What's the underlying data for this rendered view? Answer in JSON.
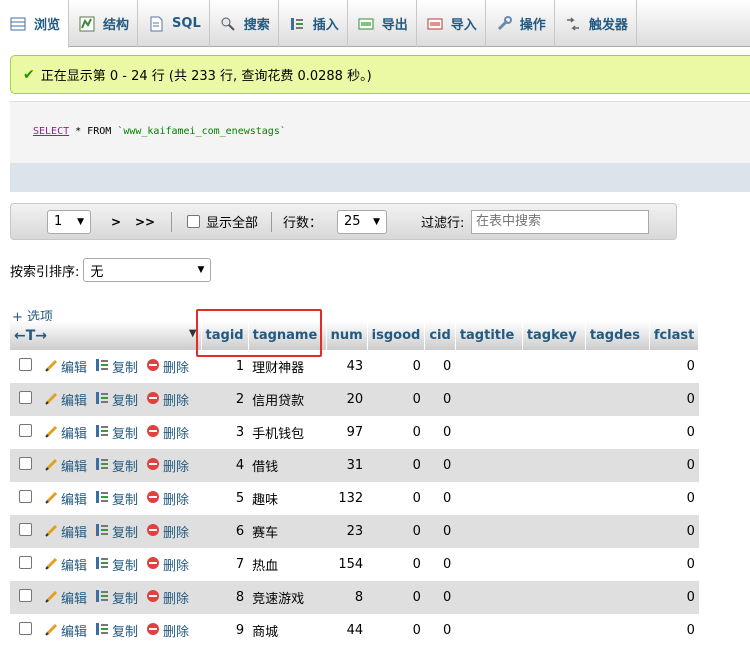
{
  "tabs": [
    {
      "label": "浏览",
      "icon": "browse-icon",
      "active": true
    },
    {
      "label": "结构",
      "icon": "structure-icon"
    },
    {
      "label": "SQL",
      "icon": "sql-icon"
    },
    {
      "label": "搜索",
      "icon": "search-icon"
    },
    {
      "label": "插入",
      "icon": "insert-icon"
    },
    {
      "label": "导出",
      "icon": "export-icon"
    },
    {
      "label": "导入",
      "icon": "import-icon"
    },
    {
      "label": "操作",
      "icon": "wrench-icon"
    },
    {
      "label": "触发器",
      "icon": "trigger-icon"
    }
  ],
  "message": "正在显示第 0 - 24 行 (共 233 行, 查询花费 0.0288 秒。)",
  "sql": {
    "keyword1": "SELECT",
    "rest": " * FROM ",
    "table": "`www_kaifamei_com_enewstags`"
  },
  "nav": {
    "page": "1",
    "next": ">",
    "last": ">>",
    "show_all": "显示全部",
    "rows_label": "行数：",
    "rows_value": "25",
    "filter_label": "过滤行:",
    "filter_placeholder": "在表中搜索"
  },
  "sort": {
    "label": "按索引排序:",
    "value": "无"
  },
  "options_link": "+ 选项",
  "columns": [
    "tagid",
    "tagname",
    "num",
    "isgood",
    "cid",
    "tagtitle",
    "tagkey",
    "tagdes",
    "fclast"
  ],
  "actions": {
    "edit": "编辑",
    "copy": "复制",
    "delete": "删除"
  },
  "rows": [
    {
      "tagid": "1",
      "tagname": "理财神器",
      "num": "43",
      "isgood": "0",
      "cid": "0",
      "fclast": "0"
    },
    {
      "tagid": "2",
      "tagname": "信用贷款",
      "num": "20",
      "isgood": "0",
      "cid": "0",
      "fclast": "0"
    },
    {
      "tagid": "3",
      "tagname": "手机钱包",
      "num": "97",
      "isgood": "0",
      "cid": "0",
      "fclast": "0"
    },
    {
      "tagid": "4",
      "tagname": "借钱",
      "num": "31",
      "isgood": "0",
      "cid": "0",
      "fclast": "0"
    },
    {
      "tagid": "5",
      "tagname": "趣味",
      "num": "132",
      "isgood": "0",
      "cid": "0",
      "fclast": "0"
    },
    {
      "tagid": "6",
      "tagname": "赛车",
      "num": "23",
      "isgood": "0",
      "cid": "0",
      "fclast": "0"
    },
    {
      "tagid": "7",
      "tagname": "热血",
      "num": "154",
      "isgood": "0",
      "cid": "0",
      "fclast": "0"
    },
    {
      "tagid": "8",
      "tagname": "竞速游戏",
      "num": "8",
      "isgood": "0",
      "cid": "0",
      "fclast": "0"
    },
    {
      "tagid": "9",
      "tagname": "商城",
      "num": "44",
      "isgood": "0",
      "cid": "0",
      "fclast": "0"
    }
  ],
  "colors": {
    "link": "#235a81",
    "success_bg": "#ebf8a4",
    "highlight": "#e52a2a"
  }
}
